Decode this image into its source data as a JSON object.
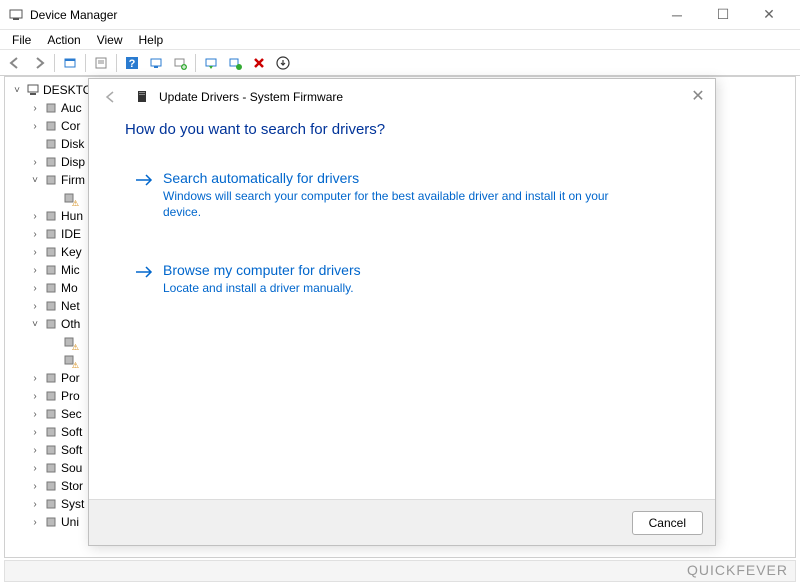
{
  "window": {
    "title": "Device Manager",
    "menu": [
      "File",
      "Action",
      "View",
      "Help"
    ]
  },
  "toolbar": {
    "back": "◄",
    "forward": "►",
    "show": "▣",
    "help": "?",
    "scan": "🖥",
    "add": "➕",
    "update": "🖵",
    "uninstall": "🖳",
    "remove": "✖",
    "props": "ⓘ"
  },
  "tree": {
    "root": "DESKTO",
    "items": [
      {
        "label": "Auc",
        "exp": ">",
        "icon": "🔊"
      },
      {
        "label": "Cor",
        "exp": ">",
        "icon": "🖥"
      },
      {
        "label": "Disk",
        "exp": "",
        "icon": "💽"
      },
      {
        "label": "Disp",
        "exp": ">",
        "icon": "🖥"
      },
      {
        "label": "Firm",
        "exp": "v",
        "icon": "🗔",
        "children": [
          {
            "label": "",
            "icon": "▮"
          }
        ]
      },
      {
        "label": "Hun",
        "exp": ">",
        "icon": "🖐"
      },
      {
        "label": "IDE",
        "exp": ">",
        "icon": "🗔"
      },
      {
        "label": "Key",
        "exp": ">",
        "icon": "⌨"
      },
      {
        "label": "Mic",
        "exp": ">",
        "icon": "🖱"
      },
      {
        "label": "Mo",
        "exp": ">",
        "icon": "🖵"
      },
      {
        "label": "Net",
        "exp": ">",
        "icon": "🖧"
      },
      {
        "label": "Oth",
        "exp": "v",
        "icon": "⚠",
        "children": [
          {
            "label": "",
            "icon": "⚠"
          },
          {
            "label": "",
            "icon": "⚠"
          }
        ]
      },
      {
        "label": "Por",
        "exp": ">",
        "icon": "🔌"
      },
      {
        "label": "Pro",
        "exp": ">",
        "icon": "▢"
      },
      {
        "label": "Sec",
        "exp": ">",
        "icon": "🔒"
      },
      {
        "label": "Soft",
        "exp": ">",
        "icon": "🗔"
      },
      {
        "label": "Soft",
        "exp": ">",
        "icon": "🗔"
      },
      {
        "label": "Sou",
        "exp": ">",
        "icon": "🔊"
      },
      {
        "label": "Stor",
        "exp": ">",
        "icon": "🗄"
      },
      {
        "label": "Syst",
        "exp": ">",
        "icon": "🖥"
      },
      {
        "label": "Uni",
        "exp": ">",
        "icon": "🔌"
      }
    ]
  },
  "dialog": {
    "title": "Update Drivers - System Firmware",
    "heading": "How do you want to search for drivers?",
    "option1": {
      "title": "Search automatically for drivers",
      "desc": "Windows will search your computer for the best available driver and install it on your device."
    },
    "option2": {
      "title": "Browse my computer for drivers",
      "desc": "Locate and install a driver manually."
    },
    "cancel": "Cancel"
  },
  "watermark": "QUICKFEVER"
}
